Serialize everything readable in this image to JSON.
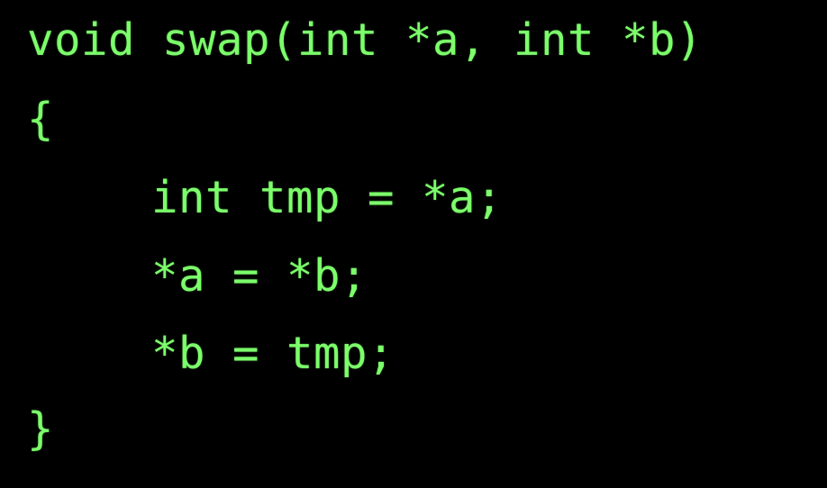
{
  "editor": {
    "background_color": "#000000",
    "text_color": "#7CFF6B",
    "lines": [
      "void swap(int *a, int *b)",
      "{",
      "int tmp = *a;",
      "*a = *b;",
      "*b = tmp;",
      "}"
    ]
  }
}
